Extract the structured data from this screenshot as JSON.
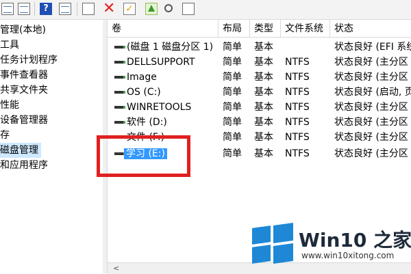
{
  "toolbar": {
    "icons": [
      "grid-view-icon",
      "properties-icon",
      "help-icon",
      "console-tree-icon",
      "connect-icon",
      "delete-icon",
      "check-icon",
      "up-arrow-icon",
      "search-icon",
      "list-icon"
    ],
    "help_glyph": "?",
    "delete_glyph": "✕",
    "check_glyph": "✓"
  },
  "tree": {
    "items": [
      "管理(本地)",
      "工具",
      "任务计划程序",
      "事件查看器",
      "共享文件夹",
      "性能",
      "设备管理器",
      "存",
      "磁盘管理",
      "和应用程序"
    ],
    "selected_index": 8
  },
  "table": {
    "columns": [
      "卷",
      "布局",
      "类型",
      "文件系统",
      "状态"
    ],
    "rows": [
      {
        "volume": "(磁盘 1 磁盘分区 1)",
        "layout": "简单",
        "type": "基本",
        "fs": "",
        "status": "状态良好 (EFI 系统"
      },
      {
        "volume": "DELLSUPPORT",
        "layout": "简单",
        "type": "基本",
        "fs": "NTFS",
        "status": "状态良好 (主分区"
      },
      {
        "volume": "Image",
        "layout": "简单",
        "type": "基本",
        "fs": "NTFS",
        "status": "状态良好 (主分区"
      },
      {
        "volume": "OS (C:)",
        "layout": "简单",
        "type": "基本",
        "fs": "NTFS",
        "status": "状态良好 (启动, 页"
      },
      {
        "volume": "WINRETOOLS",
        "layout": "简单",
        "type": "基本",
        "fs": "NTFS",
        "status": "状态良好 (主分区"
      },
      {
        "volume": "软件 (D:)",
        "layout": "简单",
        "type": "基本",
        "fs": "NTFS",
        "status": "状态良好 (主分区"
      },
      {
        "volume": "文件 (F:)",
        "layout": "简单",
        "type": "基本",
        "fs": "NTFS",
        "status": "状态良好 (主分区"
      },
      {
        "volume": "学习 (E:)",
        "layout": "简单",
        "type": "基本",
        "fs": "NTFS",
        "status": "状态良好 (主分区"
      }
    ],
    "selected_index": 7
  },
  "scroll": {
    "left_arrow": "<"
  },
  "watermark": {
    "brand": "Win10 之家",
    "url": "www.win10xitong.com",
    "logo_color": "#1e88d6"
  },
  "colors": {
    "highlight": "#cde8ff",
    "selection": "#3399ff",
    "annotation": "#e02020"
  }
}
